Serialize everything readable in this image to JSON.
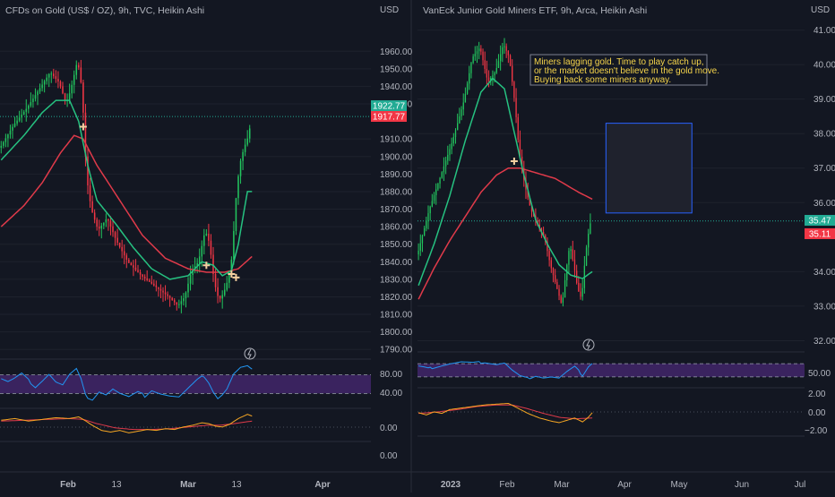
{
  "colors": {
    "bg": "#131722",
    "grid": "#1e222d",
    "axis_text": "#b2b5be",
    "up": "#089981",
    "up_bright": "#22c55e",
    "down": "#f23645",
    "ema_fast": "#26c281",
    "ema_slow": "#e03a4a",
    "rsi_line": "#2196f3",
    "rsi_zone": "#5b2d91",
    "macd": "#f5a623",
    "signal": "#e03a4a",
    "signal_marker": "#f5d0a0",
    "price_tag_up": "#22ab94",
    "price_tag_down": "#f23645",
    "note_text": "#f5d44b",
    "note_border": "#7e8290",
    "box_fill": "#1f222d",
    "box_border": "#2962ff"
  },
  "chart_data": [
    {
      "type": "candlestick",
      "title": "CFDs on Gold (US$ / OZ), 9h, TVC, Heikin Ashi",
      "currency": "USD",
      "ylim": [
        1785,
        1978
      ],
      "y_ticks": [
        "1960.00",
        "1950.00",
        "1940.00",
        "1930.00",
        "1910.00",
        "1900.00",
        "1890.00",
        "1880.00",
        "1870.00",
        "1860.00",
        "1850.00",
        "1840.00",
        "1830.00",
        "1820.00",
        "1810.00",
        "1800.00",
        "1790.00"
      ],
      "x_ticks": [
        "Feb",
        "13",
        "Mar",
        "13",
        "Apr"
      ],
      "last_price": "1922.77",
      "prev_price": "1917.77",
      "price_path": [
        [
          0,
          1905
        ],
        [
          6,
          1918
        ],
        [
          12,
          1928
        ],
        [
          18,
          1940
        ],
        [
          22,
          1948
        ],
        [
          26,
          1942
        ],
        [
          29,
          1930
        ],
        [
          31,
          1938
        ],
        [
          34,
          1955
        ],
        [
          36,
          1938
        ],
        [
          37,
          1912
        ],
        [
          38,
          1888
        ],
        [
          40,
          1870
        ],
        [
          43,
          1858
        ],
        [
          47,
          1865
        ],
        [
          51,
          1852
        ],
        [
          56,
          1840
        ],
        [
          62,
          1832
        ],
        [
          68,
          1826
        ],
        [
          74,
          1820
        ],
        [
          78,
          1815
        ],
        [
          81,
          1820
        ],
        [
          84,
          1835
        ],
        [
          87,
          1840
        ],
        [
          89,
          1852
        ],
        [
          90,
          1858
        ],
        [
          92,
          1850
        ],
        [
          93,
          1838
        ],
        [
          94,
          1828
        ],
        [
          96,
          1818
        ],
        [
          98,
          1822
        ],
        [
          100,
          1830
        ],
        [
          102,
          1845
        ],
        [
          103,
          1870
        ],
        [
          105,
          1895
        ],
        [
          107,
          1905
        ],
        [
          109,
          1912
        ],
        [
          110,
          1920
        ]
      ],
      "candle_count": 110,
      "ema_fast": [
        [
          0,
          1898
        ],
        [
          10,
          1912
        ],
        [
          18,
          1925
        ],
        [
          24,
          1932
        ],
        [
          30,
          1932
        ],
        [
          34,
          1920
        ],
        [
          38,
          1895
        ],
        [
          42,
          1875
        ],
        [
          50,
          1862
        ],
        [
          58,
          1848
        ],
        [
          66,
          1836
        ],
        [
          74,
          1830
        ],
        [
          82,
          1832
        ],
        [
          88,
          1840
        ],
        [
          93,
          1838
        ],
        [
          97,
          1832
        ],
        [
          101,
          1835
        ],
        [
          104,
          1850
        ],
        [
          108,
          1880
        ]
      ],
      "ema_slow": [
        [
          0,
          1860
        ],
        [
          10,
          1872
        ],
        [
          18,
          1885
        ],
        [
          26,
          1902
        ],
        [
          32,
          1912
        ],
        [
          36,
          1910
        ],
        [
          42,
          1895
        ],
        [
          52,
          1875
        ],
        [
          62,
          1855
        ],
        [
          72,
          1842
        ],
        [
          82,
          1836
        ],
        [
          90,
          1834
        ],
        [
          98,
          1834
        ],
        [
          104,
          1836
        ],
        [
          110,
          1843
        ]
      ],
      "signals": [
        [
          36,
          1917
        ],
        [
          90,
          1838
        ],
        [
          101,
          1833
        ],
        [
          103,
          1831
        ]
      ],
      "rsi": {
        "label_high": "80.00",
        "label_low": "40.00",
        "range": [
          0,
          100
        ],
        "band": [
          30,
          70
        ],
        "values": [
          [
            0,
            62
          ],
          [
            3,
            55
          ],
          [
            6,
            62
          ],
          [
            9,
            72
          ],
          [
            12,
            58
          ],
          [
            15,
            45
          ],
          [
            18,
            58
          ],
          [
            21,
            72
          ],
          [
            24,
            55
          ],
          [
            27,
            48
          ],
          [
            30,
            70
          ],
          [
            33,
            82
          ],
          [
            35,
            60
          ],
          [
            37,
            25
          ],
          [
            40,
            18
          ],
          [
            43,
            35
          ],
          [
            46,
            28
          ],
          [
            49,
            40
          ],
          [
            52,
            30
          ],
          [
            56,
            22
          ],
          [
            60,
            32
          ],
          [
            63,
            25
          ],
          [
            66,
            38
          ],
          [
            70,
            30
          ],
          [
            74,
            25
          ],
          [
            78,
            22
          ],
          [
            82,
            40
          ],
          [
            86,
            58
          ],
          [
            89,
            68
          ],
          [
            91,
            55
          ],
          [
            93,
            35
          ],
          [
            95,
            20
          ],
          [
            97,
            28
          ],
          [
            99,
            40
          ],
          [
            102,
            72
          ],
          [
            105,
            85
          ],
          [
            108,
            88
          ],
          [
            110,
            80
          ]
        ]
      },
      "macd": {
        "label": "0.00",
        "range": [
          -20,
          14
        ],
        "macd": [
          [
            0,
            2
          ],
          [
            6,
            4
          ],
          [
            12,
            1
          ],
          [
            18,
            3
          ],
          [
            24,
            5
          ],
          [
            30,
            4
          ],
          [
            34,
            6
          ],
          [
            36,
            3
          ],
          [
            40,
            -4
          ],
          [
            44,
            -10
          ],
          [
            48,
            -12
          ],
          [
            52,
            -10
          ],
          [
            56,
            -13
          ],
          [
            60,
            -11
          ],
          [
            64,
            -9
          ],
          [
            68,
            -10
          ],
          [
            72,
            -8
          ],
          [
            76,
            -9
          ],
          [
            80,
            -6
          ],
          [
            84,
            -4
          ],
          [
            88,
            -1
          ],
          [
            91,
            -2
          ],
          [
            94,
            -5
          ],
          [
            97,
            -6
          ],
          [
            100,
            -3
          ],
          [
            104,
            4
          ],
          [
            108,
            9
          ],
          [
            110,
            7
          ]
        ],
        "signal": [
          [
            0,
            1
          ],
          [
            10,
            2
          ],
          [
            20,
            3
          ],
          [
            30,
            4
          ],
          [
            36,
            3
          ],
          [
            42,
            -2
          ],
          [
            50,
            -7
          ],
          [
            58,
            -9
          ],
          [
            66,
            -9
          ],
          [
            74,
            -8
          ],
          [
            82,
            -6
          ],
          [
            90,
            -4
          ],
          [
            96,
            -4
          ],
          [
            102,
            -2
          ],
          [
            110,
            1
          ]
        ]
      },
      "bottom_axis_label": "0.00"
    },
    {
      "type": "candlestick",
      "title": "VanEck Junior Gold Miners ETF, 9h, Arca, Heikin Ashi",
      "currency": "USD",
      "ylim": [
        31.7,
        41.3
      ],
      "y_ticks": [
        "41.00",
        "40.00",
        "39.00",
        "38.00",
        "37.00",
        "36.00",
        "34.00",
        "33.00",
        "32.00"
      ],
      "x_ticks": [
        "2023",
        "Feb",
        "Mar",
        "Apr",
        "May",
        "Jun",
        "Jul"
      ],
      "last_price": "35.47",
      "prev_price": "35.11",
      "note": [
        "Miners lagging gold. Time to play catch up,",
        "or the market doesn't believe in the gold move.",
        "Buying back some miners anyway."
      ],
      "price_path": [
        [
          0,
          34.5
        ],
        [
          6,
          35.8
        ],
        [
          12,
          36.8
        ],
        [
          18,
          37.8
        ],
        [
          24,
          39.0
        ],
        [
          28,
          40.2
        ],
        [
          32,
          40.5
        ],
        [
          36,
          39.5
        ],
        [
          40,
          39.8
        ],
        [
          44,
          40.6
        ],
        [
          47,
          40.2
        ],
        [
          50,
          38.8
        ],
        [
          52,
          37.5
        ],
        [
          55,
          36.5
        ],
        [
          58,
          35.8
        ],
        [
          62,
          35.3
        ],
        [
          65,
          35.0
        ],
        [
          68,
          34.2
        ],
        [
          71,
          33.6
        ],
        [
          74,
          33.0
        ],
        [
          76,
          34.0
        ],
        [
          78,
          34.8
        ],
        [
          80,
          34.2
        ],
        [
          82,
          33.5
        ],
        [
          84,
          33.2
        ],
        [
          86,
          34.5
        ],
        [
          88,
          35.3
        ],
        [
          89,
          35.5
        ]
      ],
      "candle_count": 89,
      "ema_fast": [
        [
          0,
          33.6
        ],
        [
          8,
          34.8
        ],
        [
          16,
          36.2
        ],
        [
          24,
          37.8
        ],
        [
          32,
          39.2
        ],
        [
          38,
          39.6
        ],
        [
          44,
          39.3
        ],
        [
          48,
          38.3
        ],
        [
          54,
          36.8
        ],
        [
          60,
          35.5
        ],
        [
          66,
          34.8
        ],
        [
          72,
          34.2
        ],
        [
          78,
          33.9
        ],
        [
          84,
          33.8
        ],
        [
          89,
          34.0
        ]
      ],
      "ema_slow": [
        [
          0,
          33.2
        ],
        [
          8,
          34.1
        ],
        [
          16,
          34.9
        ],
        [
          24,
          35.6
        ],
        [
          32,
          36.3
        ],
        [
          40,
          36.8
        ],
        [
          46,
          37.0
        ],
        [
          52,
          37.0
        ],
        [
          58,
          36.9
        ],
        [
          64,
          36.8
        ],
        [
          70,
          36.7
        ],
        [
          76,
          36.5
        ],
        [
          82,
          36.3
        ],
        [
          89,
          36.1
        ]
      ],
      "signals": [
        [
          49,
          37.2
        ]
      ],
      "annotation_box": {
        "x0": 96,
        "x1": 140,
        "y0": 38.3,
        "y1": 35.7
      },
      "rsi": {
        "label": "50.00",
        "range": [
          0,
          100
        ],
        "band": [
          30,
          70
        ],
        "values": [
          [
            0,
            62
          ],
          [
            5,
            55
          ],
          [
            10,
            62
          ],
          [
            16,
            70
          ],
          [
            22,
            75
          ],
          [
            28,
            72
          ],
          [
            34,
            75
          ],
          [
            40,
            68
          ],
          [
            44,
            72
          ],
          [
            48,
            50
          ],
          [
            52,
            32
          ],
          [
            56,
            25
          ],
          [
            60,
            34
          ],
          [
            64,
            28
          ],
          [
            68,
            30
          ],
          [
            72,
            26
          ],
          [
            76,
            45
          ],
          [
            80,
            60
          ],
          [
            82,
            48
          ],
          [
            84,
            35
          ],
          [
            87,
            62
          ],
          [
            89,
            72
          ]
        ]
      },
      "macd": {
        "labels": [
          "2.00",
          "0.00",
          "−2.00"
        ],
        "range": [
          -3.2,
          3.2
        ],
        "macd": [
          [
            0,
            0.2
          ],
          [
            4,
            -0.1
          ],
          [
            8,
            0.3
          ],
          [
            12,
            0.1
          ],
          [
            16,
            0.6
          ],
          [
            22,
            0.8
          ],
          [
            28,
            1.0
          ],
          [
            34,
            1.2
          ],
          [
            40,
            1.3
          ],
          [
            46,
            1.4
          ],
          [
            50,
            0.9
          ],
          [
            56,
            0.1
          ],
          [
            62,
            -0.5
          ],
          [
            68,
            -0.9
          ],
          [
            72,
            -1.1
          ],
          [
            76,
            -0.8
          ],
          [
            80,
            -0.5
          ],
          [
            84,
            -1.0
          ],
          [
            87,
            -0.4
          ],
          [
            89,
            0.2
          ]
        ],
        "signal": [
          [
            0,
            0.1
          ],
          [
            10,
            0.3
          ],
          [
            20,
            0.6
          ],
          [
            30,
            1.0
          ],
          [
            40,
            1.2
          ],
          [
            48,
            1.2
          ],
          [
            56,
            0.7
          ],
          [
            64,
            0.1
          ],
          [
            72,
            -0.4
          ],
          [
            80,
            -0.6
          ],
          [
            89,
            -0.5
          ]
        ]
      }
    }
  ]
}
